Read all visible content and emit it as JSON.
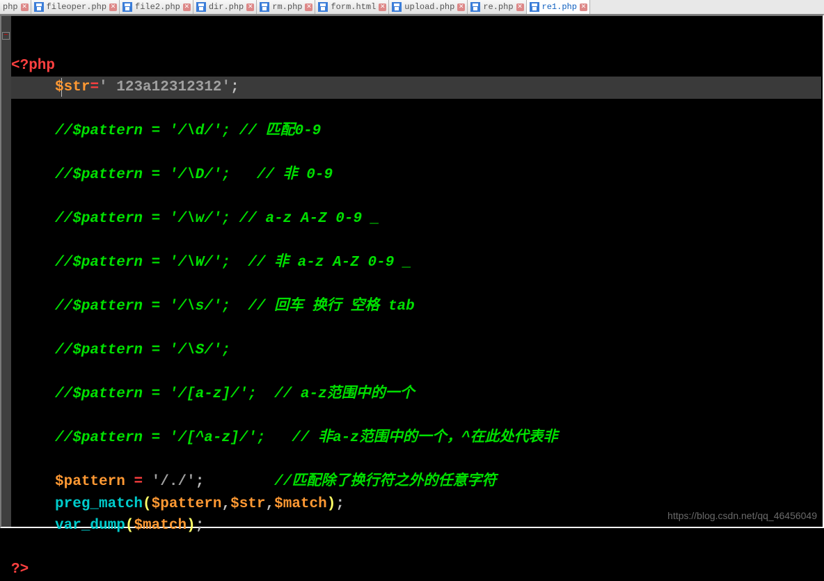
{
  "tabs": [
    {
      "label": "php",
      "icon": false
    },
    {
      "label": "fileoper.php",
      "icon": true
    },
    {
      "label": "file2.php",
      "icon": true
    },
    {
      "label": "dir.php",
      "icon": true
    },
    {
      "label": "rm.php",
      "icon": true
    },
    {
      "label": "form.html",
      "icon": true
    },
    {
      "label": "upload.php",
      "icon": true
    },
    {
      "label": "re.php",
      "icon": true
    },
    {
      "label": "re1.php",
      "icon": true,
      "active": true
    }
  ],
  "fold_symbol": "−",
  "code": {
    "open_tag": "<?php",
    "close_tag": "?>",
    "str_var": "$str",
    "assign": "=",
    "str_val": "' 123a12312312'",
    "semi": ";",
    "comments": [
      "//$pattern = '/\\d/'; // 匹配0-9",
      "//$pattern = '/\\D/';   // 非 0-9",
      "//$pattern = '/\\w/'; // a-z A-Z 0-9 _",
      "//$pattern = '/\\W/';  // 非 a-z A-Z 0-9 _",
      "//$pattern = '/\\s/';  // 回车 换行 空格 tab",
      "//$pattern = '/\\S/';",
      "//$pattern = '/[a-z]/';  // a-z范围中的一个",
      "//$pattern = '/[^a-z]/';   // 非a-z范围中的一个，^在此处代表非"
    ],
    "pattern_var": "$pattern",
    "pattern_val": "'/./'",
    "pattern_comment": "//匹配除了换行符之外的任意字符",
    "preg_fn": "preg_match",
    "preg_args_var1": "$pattern",
    "preg_args_var2": "$str",
    "preg_args_var3": "$match",
    "vardump_fn": "var_dump",
    "vardump_arg": "$match",
    "comma": ",",
    "lparen": "(",
    "rparen": ")",
    "indent": "     ",
    "pad": "        "
  },
  "watermark": "https://blog.csdn.net/qq_46456049"
}
